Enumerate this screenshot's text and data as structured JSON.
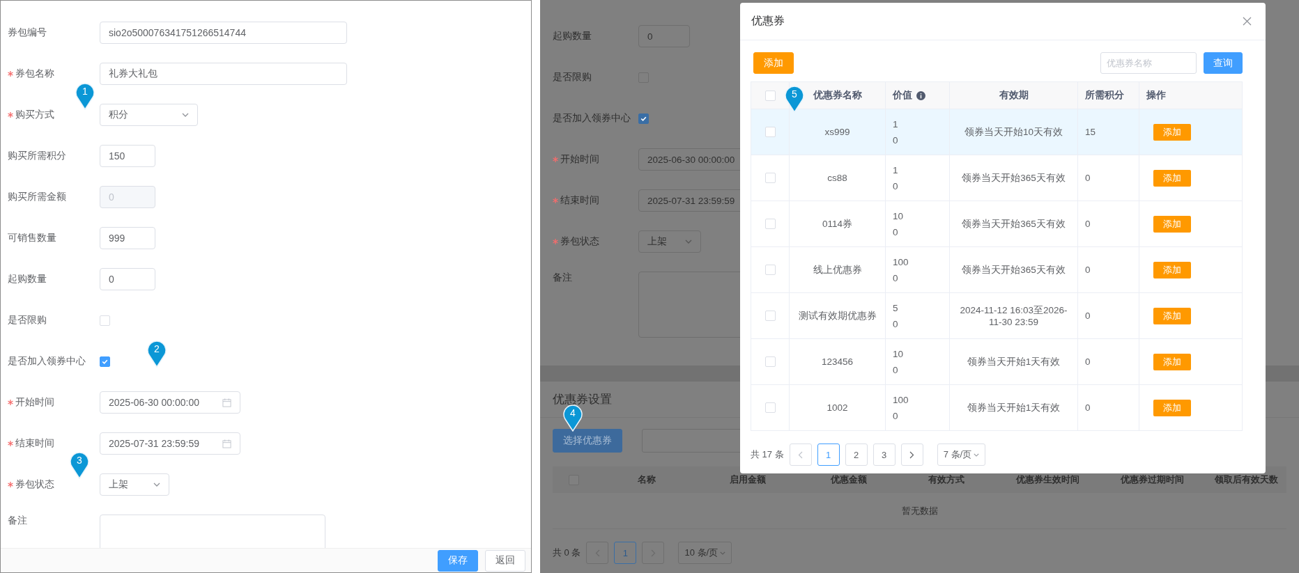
{
  "left_form": {
    "fields": [
      {
        "label": "券包编号",
        "required": false,
        "kind": "text",
        "value": "sio2o500076341751266514744",
        "disabled": false
      },
      {
        "label": "券包名称",
        "required": true,
        "kind": "text",
        "value": "礼券大礼包",
        "disabled": false
      },
      {
        "label": "购买方式",
        "required": true,
        "kind": "select",
        "value": "积分"
      },
      {
        "label": "购买所需积分",
        "required": false,
        "kind": "text",
        "value": "150",
        "disabled": false
      },
      {
        "label": "购买所需金额",
        "required": false,
        "kind": "text",
        "value": "0",
        "disabled": true
      },
      {
        "label": "可销售数量",
        "required": false,
        "kind": "text",
        "value": "999",
        "disabled": false
      },
      {
        "label": "起购数量",
        "required": false,
        "kind": "text",
        "value": "0",
        "disabled": false
      },
      {
        "label": "是否限购",
        "required": false,
        "kind": "checkbox",
        "checked": false
      },
      {
        "label": "是否加入领券中心",
        "required": false,
        "kind": "checkbox",
        "checked": true
      },
      {
        "label": "开始时间",
        "required": true,
        "kind": "date",
        "value": "2025-06-30 00:00:00"
      },
      {
        "label": "结束时间",
        "required": true,
        "kind": "date",
        "value": "2025-07-31 23:59:59"
      },
      {
        "label": "券包状态",
        "required": true,
        "kind": "select",
        "value": "上架"
      },
      {
        "label": "备注",
        "required": false,
        "kind": "textarea"
      }
    ],
    "buttons": [
      {
        "label": "保存",
        "kind": "primary"
      },
      {
        "label": "返回",
        "kind": "default"
      }
    ]
  },
  "background_form": {
    "fields": [
      {
        "label": "起购数量",
        "required": false,
        "kind": "text",
        "value": "0"
      },
      {
        "label": "是否限购",
        "required": false,
        "kind": "checkbox",
        "checked": false
      },
      {
        "label": "是否加入领券中心",
        "required": false,
        "kind": "checkbox",
        "checked": true
      },
      {
        "label": "开始时间",
        "required": true,
        "kind": "date",
        "value": "2025-06-30 00:00:00"
      },
      {
        "label": "结束时间",
        "required": true,
        "kind": "date",
        "value": "2025-07-31 23:59:59"
      },
      {
        "label": "券包状态",
        "required": true,
        "kind": "select",
        "value": "上架"
      },
      {
        "label": "备注",
        "required": false,
        "kind": "textarea"
      }
    ],
    "section_title": "优惠券设置",
    "select_button": "选择优惠券",
    "table": {
      "header_checked": false,
      "columns": [
        "名称",
        "启用金额",
        "优惠金额",
        "有效方式",
        "优惠券生效时间",
        "优惠券过期时间",
        "领取后有效天数"
      ],
      "empty_text": "暂无数据"
    },
    "pagination": {
      "total": "共 0 条",
      "pages": [
        {
          "label": "1",
          "selected": true
        }
      ],
      "page_size": "10 条/页"
    }
  },
  "dialog": {
    "title": "优惠券",
    "add_button": "添加",
    "search": {
      "placeholder": "优惠券名称"
    },
    "query_button": "查询",
    "table": {
      "header_checked": false,
      "columns": [
        {
          "label": "优惠券名称",
          "info": false
        },
        {
          "label": "价值",
          "info": true
        },
        {
          "label": "有效期",
          "info": false
        },
        {
          "label": "所需积分",
          "info": false
        },
        {
          "label": "操作",
          "info": false
        }
      ],
      "rows": [
        {
          "checked": false,
          "highlighted": true,
          "name": "xs999",
          "value_lines": [
            "1",
            "0"
          ],
          "validity": "领券当天开始10天有效",
          "points": "15",
          "action": "添加"
        },
        {
          "checked": false,
          "highlighted": false,
          "name": "cs88",
          "value_lines": [
            "1",
            "0"
          ],
          "validity": "领券当天开始365天有效",
          "points": "0",
          "action": "添加"
        },
        {
          "checked": false,
          "highlighted": false,
          "name": "0114券",
          "value_lines": [
            "10",
            "0"
          ],
          "validity": "领券当天开始365天有效",
          "points": "0",
          "action": "添加"
        },
        {
          "checked": false,
          "highlighted": false,
          "name": "线上优惠券",
          "value_lines": [
            "100",
            "0"
          ],
          "validity": "领券当天开始365天有效",
          "points": "0",
          "action": "添加"
        },
        {
          "checked": false,
          "highlighted": false,
          "name": "测试有效期优惠券",
          "value_lines": [
            "5",
            "0"
          ],
          "validity": "2024-11-12 16:03至2026-11-30 23:59",
          "points": "0",
          "action": "添加"
        },
        {
          "checked": false,
          "highlighted": false,
          "name": "123456",
          "value_lines": [
            "10",
            "0"
          ],
          "validity": "领券当天开始1天有效",
          "points": "0",
          "action": "添加"
        },
        {
          "checked": false,
          "highlighted": false,
          "name": "1002",
          "value_lines": [
            "100",
            "0"
          ],
          "validity": "领券当天开始1天有效",
          "points": "0",
          "action": "添加"
        }
      ]
    },
    "pagination": {
      "total": "共 17 条",
      "pages": [
        {
          "label": "1",
          "selected": true
        },
        {
          "label": "2",
          "selected": false
        },
        {
          "label": "3",
          "selected": false
        }
      ],
      "page_size": "7 条/页"
    }
  },
  "markers": [
    {
      "label": "1"
    },
    {
      "label": "2"
    },
    {
      "label": "3"
    },
    {
      "label": "4"
    },
    {
      "label": "5"
    }
  ]
}
